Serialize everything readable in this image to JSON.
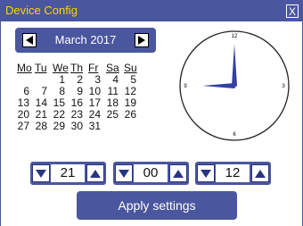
{
  "window": {
    "title": "Device Config",
    "close_label": "X"
  },
  "calendar": {
    "month_label": "March 2017",
    "weekdays": [
      "Mo",
      "Tu",
      "We",
      "Th",
      "Fr",
      "Sa",
      "Su"
    ],
    "weeks": [
      [
        "",
        "",
        "1",
        "2",
        "3",
        "4",
        "5"
      ],
      [
        "6",
        "7",
        "8",
        "9",
        "10",
        "11",
        "12"
      ],
      [
        "13",
        "14",
        "15",
        "16",
        "17",
        "18",
        "19"
      ],
      [
        "20",
        "21",
        "22",
        "23",
        "24",
        "25",
        "26"
      ],
      [
        "27",
        "28",
        "29",
        "30",
        "31",
        "",
        ""
      ]
    ]
  },
  "clock": {
    "numerals": {
      "top": "12",
      "right": "3",
      "bottom": "6",
      "left": "9"
    },
    "hour": 9,
    "minute": 0
  },
  "spinners": [
    {
      "name": "day",
      "value": "21"
    },
    {
      "name": "minute",
      "value": "00"
    },
    {
      "name": "second",
      "value": "12"
    }
  ],
  "apply_label": "Apply settings",
  "colors": {
    "accent": "#4a569e",
    "title_text": "#ffd400",
    "arrow": "#2a3580"
  }
}
